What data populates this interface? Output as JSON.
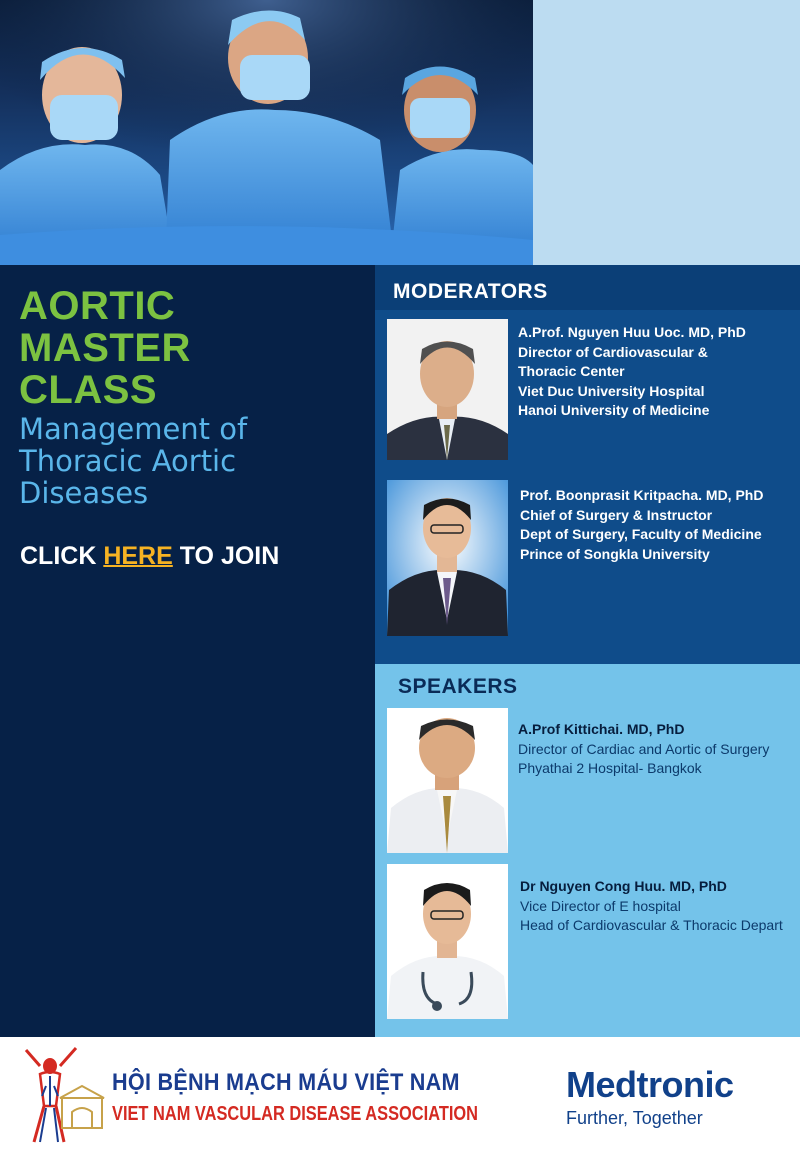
{
  "event": {
    "title_lines": [
      "AORTIC",
      "MASTER",
      "CLASS"
    ],
    "subtitle_lines": [
      "Management of",
      "Thoracic Aortic",
      "Diseases"
    ],
    "cta": {
      "prefix": "CLICK ",
      "link": "HERE",
      "suffix": " TO JOIN"
    }
  },
  "moderators": {
    "heading": "MODERATORS",
    "people": [
      {
        "name": "A.Prof. Nguyen Huu Uoc. MD, PhD",
        "lines": [
          "Director of Cardiovascular &",
          "Thoracic Center",
          "Viet Duc University Hospital",
          "Hanoi University of Medicine"
        ]
      },
      {
        "name": "Prof. Boonprasit Kritpacha. MD, PhD",
        "lines": [
          "Chief of Surgery & Instructor",
          "Dept of Surgery, Faculty of Medicine",
          "Prince of Songkla University"
        ]
      }
    ]
  },
  "speakers": {
    "heading": "SPEAKERS",
    "people": [
      {
        "name": "A.Prof  Kittichai. MD, PhD",
        "lines": [
          "Director of Cardiac and Aortic of Surgery",
          "Phyathai 2 Hospital- Bangkok"
        ]
      },
      {
        "name": "Dr Nguyen Cong Huu. MD, PhD",
        "lines": [
          "Vice Director of E hospital",
          "Head of Cardiovascular & Thoracic Depart"
        ]
      }
    ]
  },
  "footer": {
    "association_vn": "HỘI BỆNH MẠCH MÁU VIỆT NAM",
    "association_en": "VIET NAM VASCULAR DISEASE ASSOCIATION",
    "sponsor_name": "Medtronic",
    "sponsor_tagline": "Further, Together"
  },
  "colors": {
    "navy": "#062147",
    "moderator_blue": "#0f4c8a",
    "speaker_blue": "#74c3ea",
    "title_green": "#7cc241",
    "subtitle_blue": "#5ab6ea",
    "link_orange": "#f6b323"
  },
  "icons": [
    "vascular-association-logo",
    "surgeons-photo",
    "portrait-photo"
  ]
}
